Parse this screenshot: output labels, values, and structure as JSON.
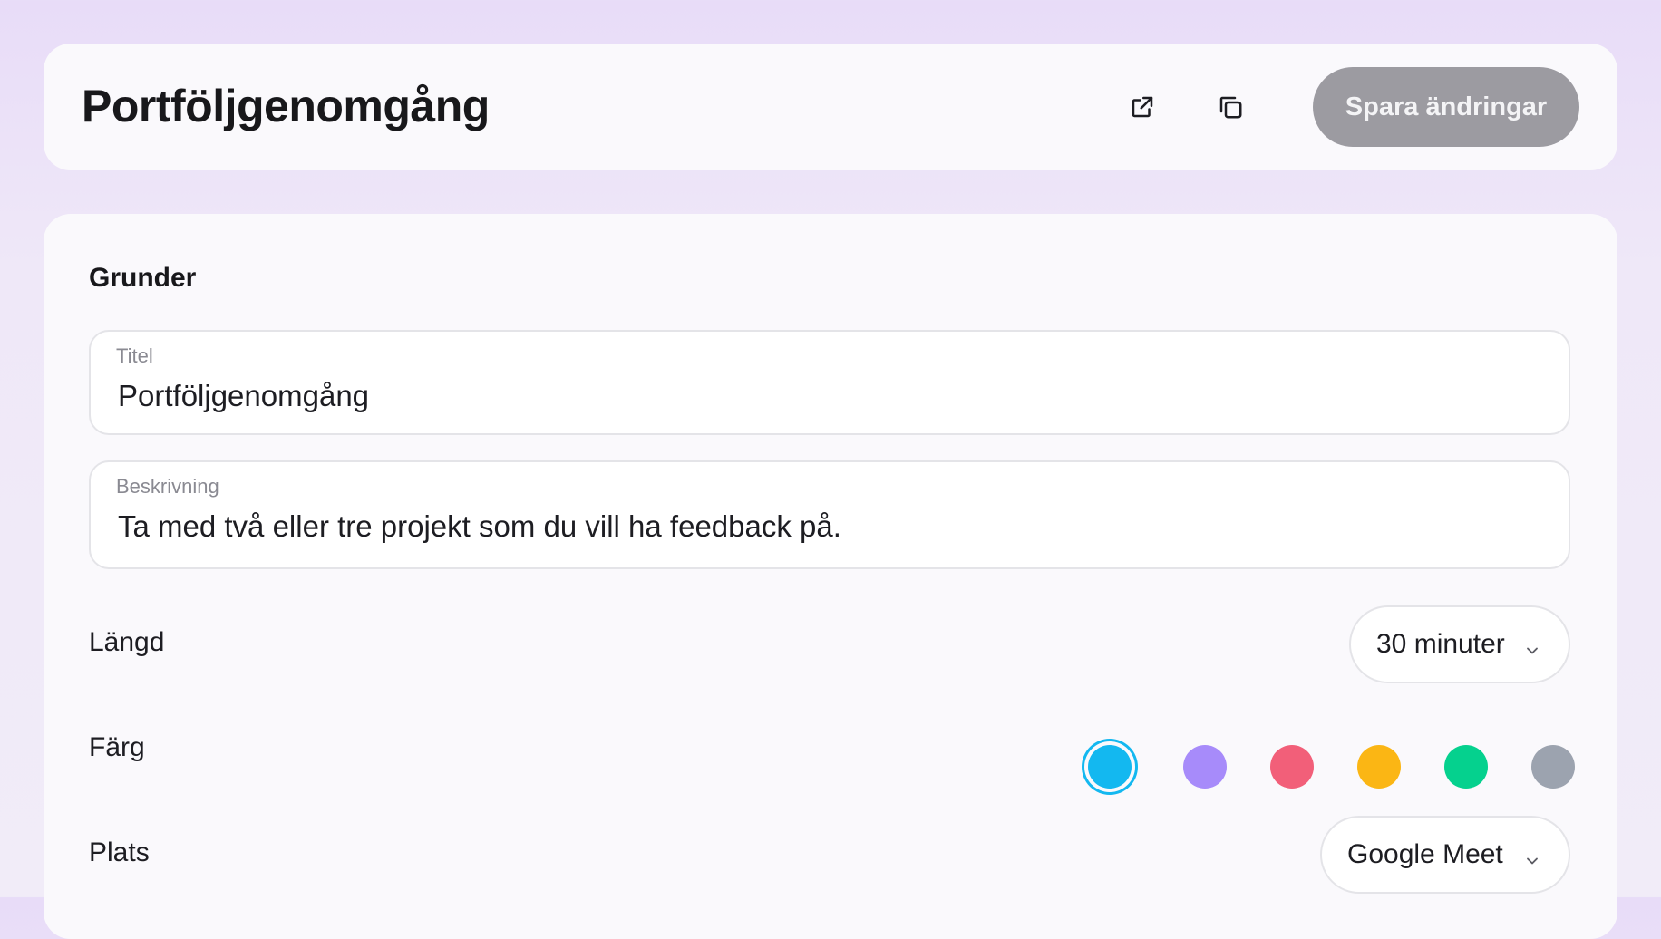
{
  "header": {
    "title": "Portföljgenomgång",
    "open_icon": "external-link-icon",
    "copy_icon": "copy-icon",
    "save_label": "Spara ändringar"
  },
  "section": {
    "heading": "Grunder"
  },
  "fields": {
    "title": {
      "label": "Titel",
      "value": "Portföljgenomgång"
    },
    "description": {
      "label": "Beskrivning",
      "value": "Ta med två eller tre projekt som du vill ha feedback på."
    }
  },
  "length": {
    "label": "Längd",
    "selected": "30 minuter"
  },
  "color": {
    "label": "Färg",
    "selected_index": 0,
    "options": [
      "#13b8f0",
      "#a78bfa",
      "#f25f79",
      "#fbb614",
      "#05d18e",
      "#9ca3af"
    ]
  },
  "place": {
    "label": "Plats",
    "selected": "Google Meet"
  }
}
